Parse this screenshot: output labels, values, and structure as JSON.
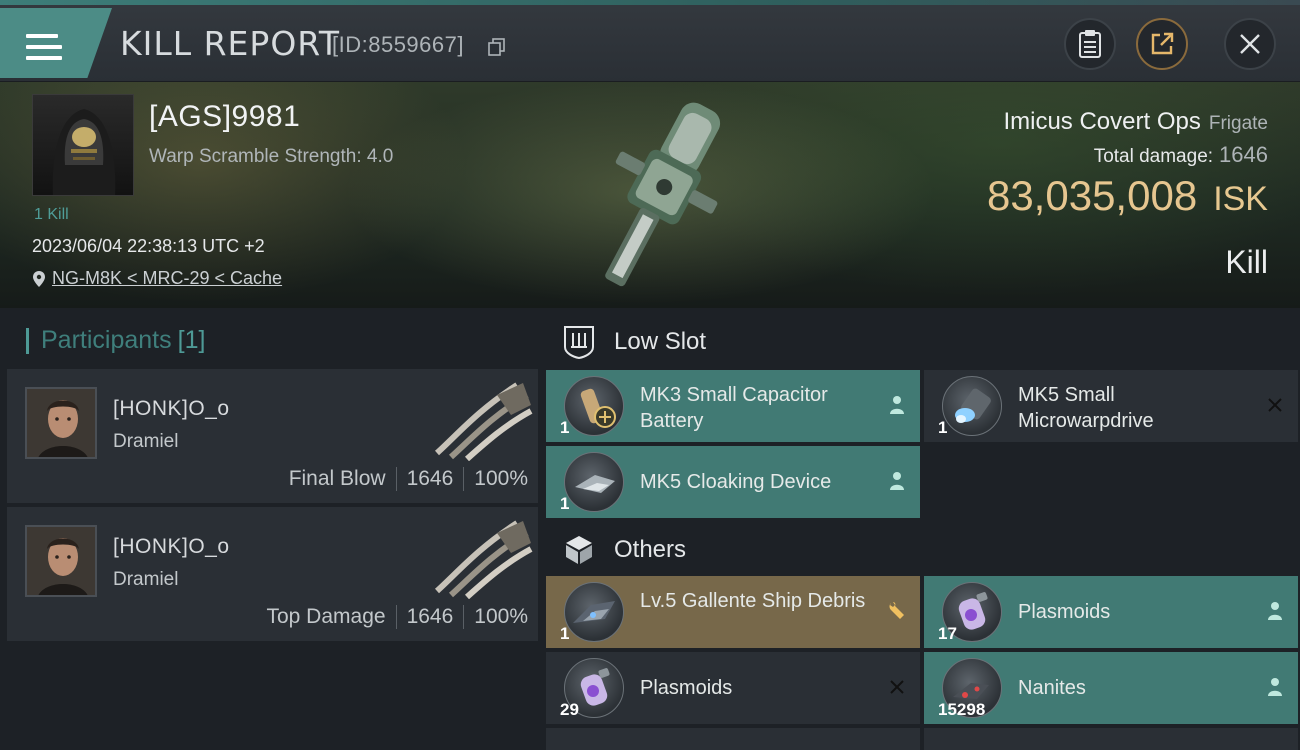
{
  "header": {
    "title": "KILL REPORT",
    "report_id": "[ID:8559667]",
    "icons": {
      "menu": "menu-icon",
      "copy": "copy-icon",
      "clipboard": "clipboard-icon",
      "share": "share-icon",
      "close": "close-icon"
    }
  },
  "victim": {
    "name": "[AGS]9981",
    "warp_scramble": "Warp Scramble Strength: 4.0",
    "kills": "1 Kill",
    "datetime": "2023/06/04 22:38:13 UTC +2",
    "location": "NG-M8K < MRC-29 < Cache"
  },
  "ship": {
    "name": "Imicus Covert Ops",
    "class": "Frigate",
    "total_damage_label": "Total damage:",
    "total_damage": "1646",
    "value": "83,035,008",
    "currency": "ISK",
    "result": "Kill"
  },
  "participants": {
    "label": "Participants",
    "count": "[1]",
    "items": [
      {
        "name": "[HONK]O_o",
        "ship": "Dramiel",
        "role": "Final Blow",
        "damage": "1646",
        "percent": "100%"
      },
      {
        "name": "[HONK]O_o",
        "ship": "Dramiel",
        "role": "Top Damage",
        "damage": "1646",
        "percent": "100%"
      }
    ]
  },
  "sections": {
    "low_slot": "Low Slot",
    "others": "Others"
  },
  "low_slot_items": [
    {
      "name": "MK3 Small Capacitor Battery",
      "qty": "1",
      "status_icon": "person-icon"
    },
    {
      "name": "MK5 Small Microwarpdrive",
      "qty": "1",
      "status_icon": "x-icon"
    },
    {
      "name": "MK5 Cloaking Device",
      "qty": "1",
      "status_icon": "person-icon"
    }
  ],
  "other_items": [
    {
      "name": "Lv.5 Gallente Ship Debris",
      "qty": "1",
      "status_icon": "wrench-icon"
    },
    {
      "name": "Plasmoids",
      "qty": "17",
      "status_icon": "person-icon"
    },
    {
      "name": "Plasmoids",
      "qty": "29",
      "status_icon": "x-icon"
    },
    {
      "name": "Nanites",
      "qty": "15298",
      "status_icon": "person-icon"
    }
  ],
  "colors": {
    "accent_teal": "#417a74",
    "dropped_gold": "#77684a",
    "isk_gold": "#e6c690"
  }
}
